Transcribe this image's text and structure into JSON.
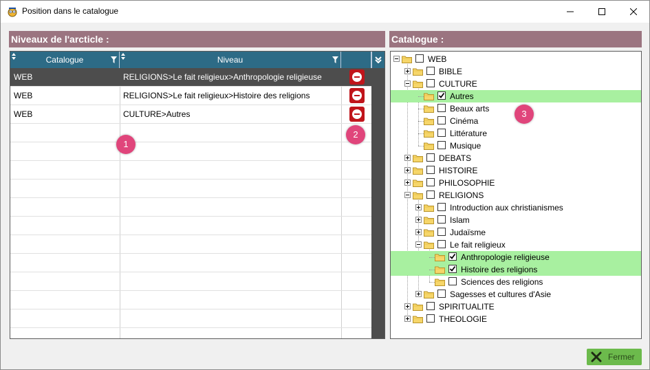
{
  "window": {
    "title": "Position dans le catalogue",
    "minimize_icon": "minimize-icon",
    "maximize_icon": "maximize-icon",
    "close_icon": "close-icon"
  },
  "left_panel": {
    "header": "Niveaux de l'arcticle :",
    "columns": [
      "Catalogue",
      "Niveau"
    ],
    "rows": [
      {
        "catalogue": "WEB",
        "niveau": "RELIGIONS>Le fait religieux>Anthropologie religieuse",
        "selected": true
      },
      {
        "catalogue": "WEB",
        "niveau": "RELIGIONS>Le fait religieux>Histoire des religions",
        "selected": false
      },
      {
        "catalogue": "WEB",
        "niveau": "CULTURE>Autres",
        "selected": false
      }
    ]
  },
  "right_panel": {
    "header": "Catalogue :",
    "tree": [
      {
        "label": "WEB",
        "depth": 0,
        "expanded": true,
        "checked": false,
        "highlight": false
      },
      {
        "label": "BIBLE",
        "depth": 1,
        "expanded": false,
        "checked": false,
        "highlight": false
      },
      {
        "label": "CULTURE",
        "depth": 1,
        "expanded": true,
        "checked": false,
        "highlight": false
      },
      {
        "label": "Autres",
        "depth": 2,
        "leaf": true,
        "checked": true,
        "highlight": true
      },
      {
        "label": "Beaux arts",
        "depth": 2,
        "leaf": true,
        "checked": false,
        "highlight": false
      },
      {
        "label": "Cinéma",
        "depth": 2,
        "leaf": true,
        "checked": false,
        "highlight": false
      },
      {
        "label": "Littérature",
        "depth": 2,
        "leaf": true,
        "checked": false,
        "highlight": false
      },
      {
        "label": "Musique",
        "depth": 2,
        "leaf": true,
        "checked": false,
        "highlight": false
      },
      {
        "label": "DEBATS",
        "depth": 1,
        "expanded": false,
        "checked": false,
        "highlight": false
      },
      {
        "label": "HISTOIRE",
        "depth": 1,
        "expanded": false,
        "checked": false,
        "highlight": false
      },
      {
        "label": "PHILOSOPHIE",
        "depth": 1,
        "expanded": false,
        "checked": false,
        "highlight": false
      },
      {
        "label": "RELIGIONS",
        "depth": 1,
        "expanded": true,
        "checked": false,
        "highlight": false
      },
      {
        "label": "Introduction aux christianismes",
        "depth": 2,
        "expanded": false,
        "checked": false,
        "highlight": false
      },
      {
        "label": "Islam",
        "depth": 2,
        "expanded": false,
        "checked": false,
        "highlight": false
      },
      {
        "label": "Judaïsme",
        "depth": 2,
        "expanded": false,
        "checked": false,
        "highlight": false
      },
      {
        "label": "Le fait religieux",
        "depth": 2,
        "expanded": true,
        "checked": false,
        "highlight": false
      },
      {
        "label": "Anthropologie religieuse",
        "depth": 3,
        "leaf": true,
        "checked": true,
        "highlight": true
      },
      {
        "label": "Histoire des religions",
        "depth": 3,
        "leaf": true,
        "checked": true,
        "highlight": true
      },
      {
        "label": "Sciences des religions",
        "depth": 3,
        "leaf": true,
        "checked": false,
        "highlight": false
      },
      {
        "label": "Sagesses et cultures d'Asie",
        "depth": 2,
        "expanded": false,
        "checked": false,
        "highlight": false
      },
      {
        "label": "SPIRITUALITE",
        "depth": 1,
        "expanded": false,
        "checked": false,
        "highlight": false
      },
      {
        "label": "THEOLOGIE",
        "depth": 1,
        "expanded": false,
        "checked": false,
        "highlight": false
      }
    ]
  },
  "badges": [
    "1",
    "2",
    "3"
  ],
  "footer": {
    "close_label": "Fermer",
    "close_icon": "x-icon"
  },
  "colors": {
    "header_bg": "#9b7480",
    "grid_header": "#2d6b86",
    "selected_row": "#4d4d4d",
    "highlight": "#a8f0a0",
    "delete": "#c0151b",
    "badge": "#e0457b",
    "close_button": "#6cba4c"
  }
}
